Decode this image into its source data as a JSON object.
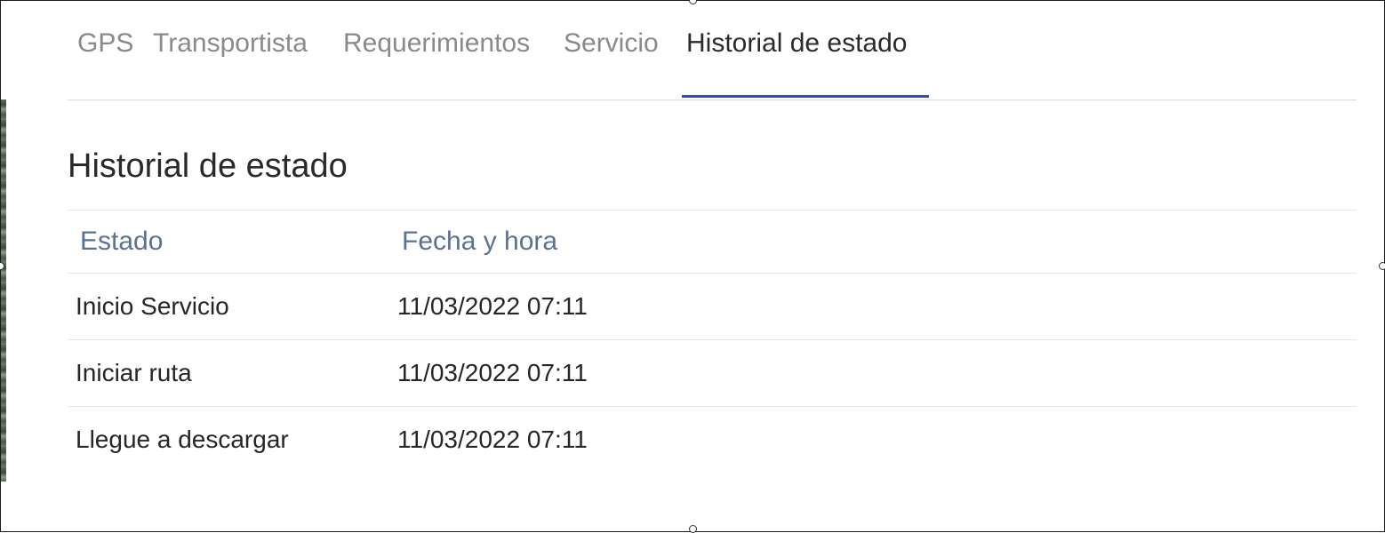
{
  "tabs": [
    {
      "label": "GPS",
      "active": false
    },
    {
      "label": "Transportista",
      "active": false
    },
    {
      "label": "Requerimientos",
      "active": false
    },
    {
      "label": "Servicio",
      "active": false
    },
    {
      "label": "Historial de estado",
      "active": true
    }
  ],
  "section": {
    "title": "Historial de estado"
  },
  "table": {
    "headers": [
      "Estado",
      "Fecha y hora"
    ],
    "rows": [
      {
        "estado": "Inicio Servicio",
        "fecha": "11/03/2022 07:11"
      },
      {
        "estado": "Iniciar ruta",
        "fecha": "11/03/2022 07:11"
      },
      {
        "estado": "Llegue a descargar",
        "fecha": "11/03/2022 07:11"
      }
    ]
  },
  "colors": {
    "accent": "#3d4ab5",
    "header_text": "#5a7291",
    "inactive_tab": "#8a8a8a"
  }
}
